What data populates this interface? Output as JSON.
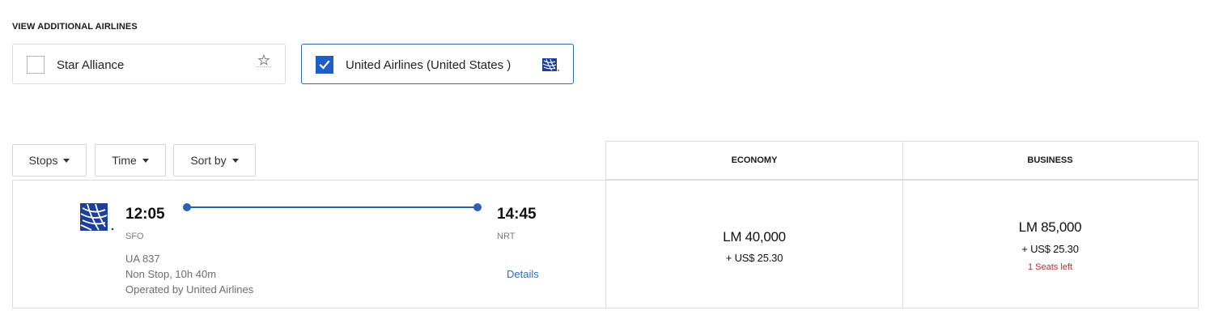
{
  "section": {
    "title": "VIEW ADDITIONAL AIRLINES"
  },
  "airline_filters": [
    {
      "label": "Star Alliance",
      "checked": false,
      "icon": "star-alliance-icon"
    },
    {
      "label": "United Airlines (United States )",
      "checked": true,
      "icon": "united-globe-icon"
    }
  ],
  "filters": {
    "stops_label": "Stops",
    "time_label": "Time",
    "sort_label": "Sort by"
  },
  "fare_headers": {
    "economy": "ECONOMY",
    "business": "BUSINESS"
  },
  "flight": {
    "depart_time": "12:05",
    "depart_airport": "SFO",
    "arrive_time": "14:45",
    "arrive_airport": "NRT",
    "flight_number": "UA 837",
    "stops_duration": "Non Stop, 10h 40m",
    "operator": "Operated by United Airlines",
    "details_label": "Details",
    "airline_icon": "united-globe-icon"
  },
  "fares": {
    "economy": {
      "price": "LM 40,000",
      "tax": "+ US$ 25.30"
    },
    "business": {
      "price": "LM 85,000",
      "tax": "+ US$ 25.30",
      "seats_left": "1 Seats left"
    }
  },
  "colors": {
    "accent": "#1d5dc7",
    "route": "#2b62b4",
    "link": "#2f6fb7",
    "warning": "#c62b2b"
  }
}
